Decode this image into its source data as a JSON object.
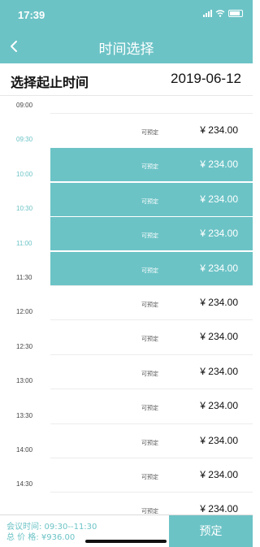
{
  "status_bar": {
    "time": "17:39"
  },
  "nav": {
    "title": "时间选择"
  },
  "header": {
    "label": "选择起止时间",
    "date": "2019-06-12"
  },
  "times": [
    {
      "label": "09:00",
      "selected": false
    },
    {
      "label": "09:30",
      "selected": true
    },
    {
      "label": "10:00",
      "selected": true
    },
    {
      "label": "10:30",
      "selected": true
    },
    {
      "label": "11:00",
      "selected": true
    },
    {
      "label": "11:30",
      "selected": false
    },
    {
      "label": "12:00",
      "selected": false
    },
    {
      "label": "12:30",
      "selected": false
    },
    {
      "label": "13:00",
      "selected": false
    },
    {
      "label": "13:30",
      "selected": false
    },
    {
      "label": "14:00",
      "selected": false
    },
    {
      "label": "14:30",
      "selected": false
    }
  ],
  "slots": [
    {
      "status": "可预定",
      "price": "¥ 234.00",
      "selected": false
    },
    {
      "status": "可预定",
      "price": "¥ 234.00",
      "selected": true
    },
    {
      "status": "可预定",
      "price": "¥ 234.00",
      "selected": true
    },
    {
      "status": "可预定",
      "price": "¥ 234.00",
      "selected": true
    },
    {
      "status": "可预定",
      "price": "¥ 234.00",
      "selected": true
    },
    {
      "status": "可预定",
      "price": "¥ 234.00",
      "selected": false
    },
    {
      "status": "可预定",
      "price": "¥ 234.00",
      "selected": false
    },
    {
      "status": "可预定",
      "price": "¥ 234.00",
      "selected": false
    },
    {
      "status": "可预定",
      "price": "¥ 234.00",
      "selected": false
    },
    {
      "status": "可预定",
      "price": "¥ 234.00",
      "selected": false
    },
    {
      "status": "可预定",
      "price": "¥ 234.00",
      "selected": false
    },
    {
      "status": "可预定",
      "price": "¥ 234.00",
      "selected": false
    }
  ],
  "footer": {
    "meeting_time": "会议时间: 09:30--11:30",
    "total_price": "总 价 格: ¥936.00",
    "book_label": "预定"
  },
  "colors": {
    "accent": "#6cc3c6",
    "text": "#111111"
  },
  "icons": {
    "back": "chevron-left-icon",
    "signal": "signal-icon",
    "wifi": "wifi-icon",
    "battery": "battery-icon"
  }
}
